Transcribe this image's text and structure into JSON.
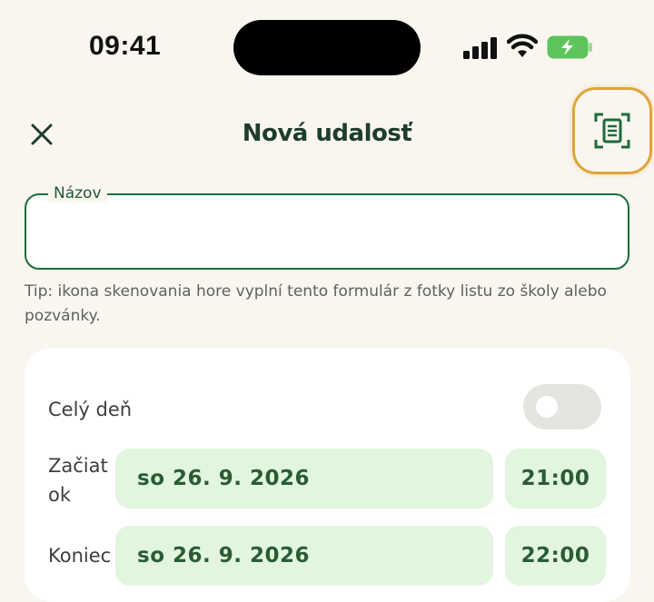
{
  "status_bar": {
    "time": "09:41"
  },
  "header": {
    "close_icon": "close-icon",
    "title": "Nová udalosť",
    "scan_icon": "document-scan-icon",
    "accent_color": "#1f6b3a",
    "highlight_color": "#e0a43a"
  },
  "form": {
    "name_field": {
      "label": "Názov",
      "value": ""
    },
    "tip": "Tip: ikona skenovania hore vyplní tento formulár z fotky listu zo školy alebo pozvánky."
  },
  "card": {
    "all_day": {
      "label": "Celý deň",
      "enabled": false
    },
    "start": {
      "label_line1": "Začiat",
      "label_line2": "ok",
      "date": "so 26. 9. 2026",
      "time": "21:00"
    },
    "end": {
      "label": "Koniec",
      "date": "so 26. 9. 2026",
      "time": "22:00"
    }
  }
}
